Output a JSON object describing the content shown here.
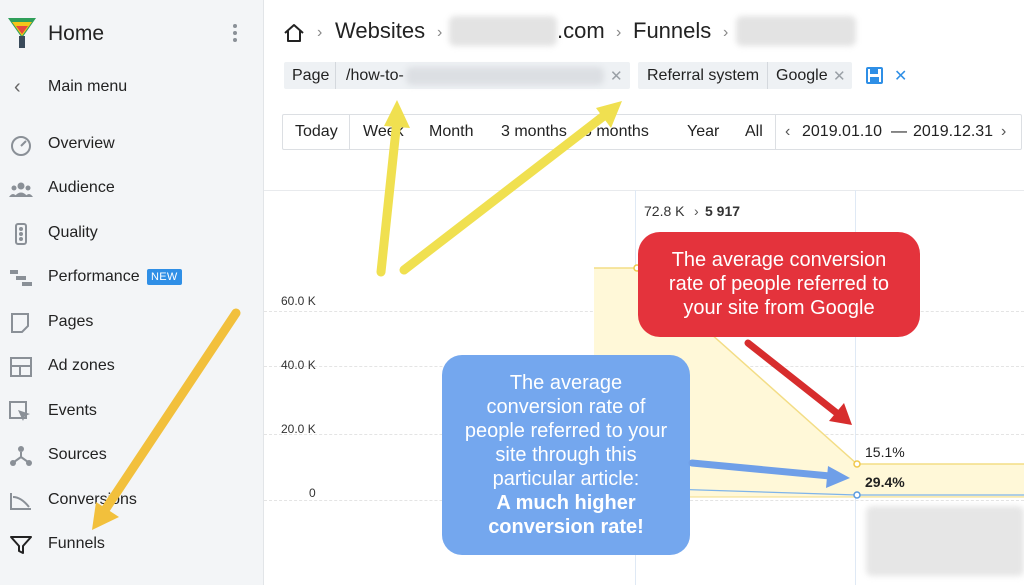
{
  "sidebar": {
    "title": "Home",
    "main_menu": "Main menu",
    "items": [
      {
        "label": "Overview",
        "icon": "gauge-icon"
      },
      {
        "label": "Audience",
        "icon": "people-icon"
      },
      {
        "label": "Quality",
        "icon": "traffic-light-icon"
      },
      {
        "label": "Performance",
        "icon": "bars-icon",
        "badge": "NEW"
      },
      {
        "label": "Pages",
        "icon": "page-icon"
      },
      {
        "label": "Ad zones",
        "icon": "layout-icon"
      },
      {
        "label": "Events",
        "icon": "cursor-icon"
      },
      {
        "label": "Sources",
        "icon": "branches-icon"
      },
      {
        "label": "Conversions",
        "icon": "conversion-icon"
      },
      {
        "label": "Funnels",
        "icon": "funnel-icon"
      }
    ]
  },
  "breadcrumb": {
    "websites": "Websites",
    "site_suffix": ".com",
    "funnels": "Funnels"
  },
  "filters": {
    "page_label": "Page",
    "page_value": "/how-to-",
    "referral_label": "Referral system",
    "referral_value": "Google"
  },
  "periods": [
    "Today",
    "Week",
    "Month",
    "3 months",
    "6 months",
    "Year",
    "All"
  ],
  "date_range": {
    "start": "2019.01.10",
    "dash": "—",
    "end": "2019.12.31"
  },
  "chart": {
    "y_ticks": [
      "60.0 K",
      "40.0 K",
      "20.0 K",
      "0"
    ],
    "top_value": "72.8 K",
    "top_value_2": "5 917",
    "rate_google": "15.1%",
    "rate_article": "29.4%"
  },
  "chart_data": {
    "type": "area",
    "series": [
      {
        "name": "Google",
        "values": [
          72800,
          5917
        ],
        "conversion_rate": "15.1%"
      },
      {
        "values": [
          5917
        ],
        "conversion_rate": "29.4%"
      }
    ],
    "y_ticks": [
      "0",
      "20.0 K",
      "40.0 K",
      "60.0 K"
    ],
    "ylim": [
      0,
      72800
    ]
  },
  "annotations": {
    "red": "The average conversion rate of people referred to your site from Google",
    "blue_lines": [
      "The average",
      "conversion rate of",
      "people referred to your",
      "site through this",
      "particular article:"
    ],
    "blue_bold_1": "A much higher",
    "blue_bold_2": "conversion rate!"
  },
  "colors": {
    "sidebar_bg": "#f3f5f7",
    "accent": "#2f8fe6",
    "red_callout": "#e4333c",
    "blue_callout": "#74a7ee",
    "yellow_arrow": "#f0e050",
    "orange_arrow": "#f2c03c",
    "funnel_fill": "#fff8d8"
  }
}
